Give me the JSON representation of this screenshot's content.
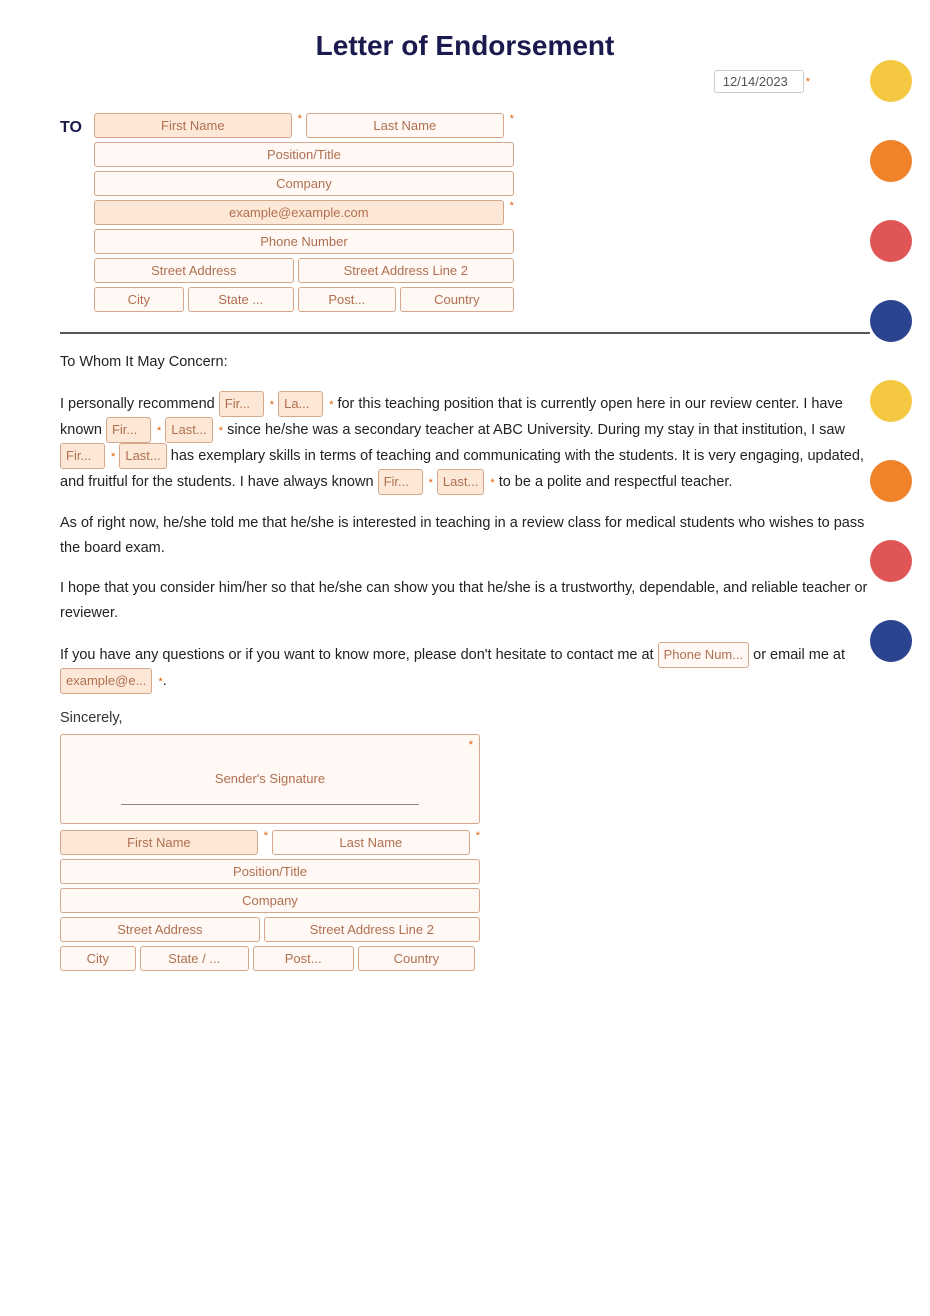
{
  "title": "Letter of Endorsement",
  "date": "12/14/2023",
  "to_label": "TO",
  "address": {
    "first_name_placeholder": "First Name",
    "last_name_placeholder": "Last Name",
    "position_placeholder": "Position/Title",
    "company_placeholder": "Company",
    "email_placeholder": "example@example.com",
    "phone_placeholder": "Phone Number",
    "street_placeholder": "Street Address",
    "street2_placeholder": "Street Address Line 2",
    "city_placeholder": "City",
    "state_placeholder": "State ...",
    "post_placeholder": "Post...",
    "country_placeholder": "Country"
  },
  "salutation": "To Whom It May Concern:",
  "paragraph1_1": "I personally recommend ",
  "paragraph1_2": " for this teaching position that is currently open here in our review center. I have known ",
  "paragraph1_3": " since he/she was a secondary teacher at ABC University. During my stay in that institution, I saw ",
  "paragraph1_4": "has exemplary skills in terms of teaching and communicating with the students. It is very engaging, updated, and fruitful for the students. I have always known ",
  "paragraph1_5": " to be a polite and respectful teacher.",
  "paragraph2": "As of right now, he/she told me that he/she is interested in teaching in a review class for medical students who wishes to pass the board exam.",
  "paragraph3": "I hope that you consider him/her so that he/she can show you that he/she is a trustworthy, dependable, and reliable teacher or reviewer.",
  "paragraph4_1": "If you have any questions or if you want to know more, please don't hesitate to contact me at ",
  "paragraph4_2": " or email me at ",
  "sincerely": "Sincerely,",
  "signature_placeholder": "Sender's Signature",
  "bottom_address": {
    "first_name_placeholder": "First Name",
    "last_name_placeholder": "Last Name",
    "position_placeholder": "Position/Title",
    "company_placeholder": "Company",
    "street_placeholder": "Street Address",
    "street2_placeholder": "Street Address Line 2",
    "city_placeholder": "City",
    "state_placeholder": "State / ...",
    "post_placeholder": "Post...",
    "country_placeholder": "Country"
  },
  "inline_fields": {
    "rec_first": "Fir...",
    "rec_last": "La...",
    "known_first1": "Fir...",
    "known_last1": "Last...",
    "saw_first": "Fir...",
    "saw_last": "Last...",
    "known_first2": "Fir...",
    "known_last2": "Last...",
    "phone": "Phone Num...",
    "email": "example@e..."
  },
  "circles": [
    {
      "color": "circle-yellow"
    },
    {
      "color": "circle-orange"
    },
    {
      "color": "circle-red"
    },
    {
      "color": "circle-blue"
    },
    {
      "color": "circle-yellow"
    },
    {
      "color": "circle-orange"
    },
    {
      "color": "circle-red"
    },
    {
      "color": "circle-blue"
    }
  ]
}
